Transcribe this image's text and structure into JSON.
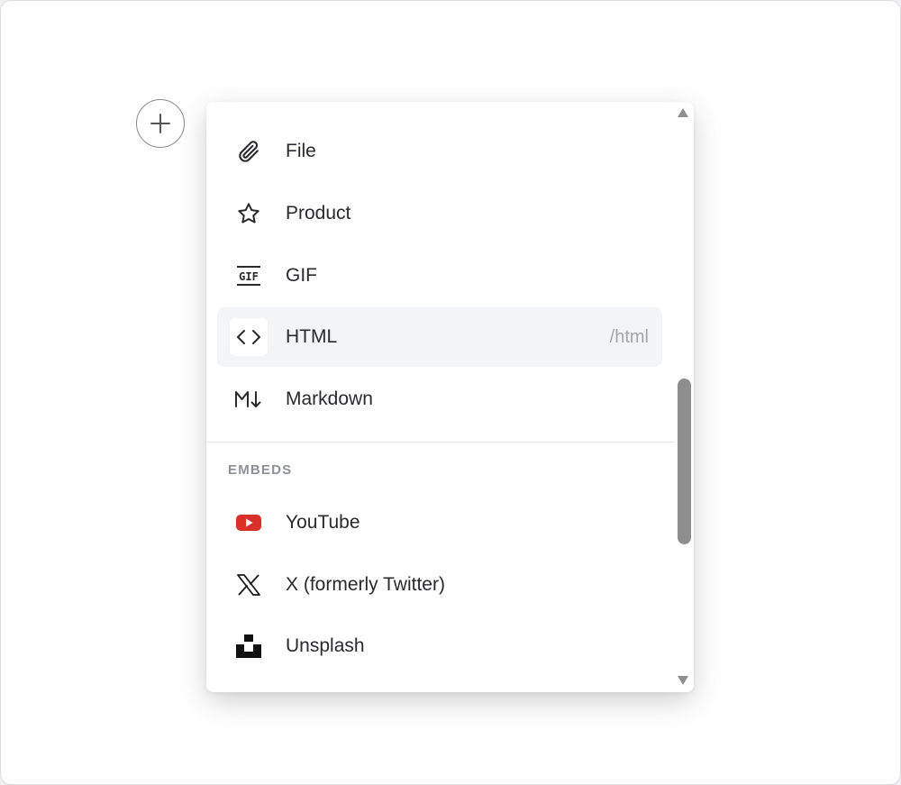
{
  "menu": {
    "items": [
      {
        "label": "File",
        "icon": "paperclip-icon"
      },
      {
        "label": "Product",
        "icon": "star-icon"
      },
      {
        "label": "GIF",
        "icon": "gif-icon"
      },
      {
        "label": "HTML",
        "icon": "code-icon",
        "shortcut": "/html",
        "active": true
      },
      {
        "label": "Markdown",
        "icon": "markdown-icon"
      }
    ],
    "embeds_header": "EMBEDS",
    "embeds": [
      {
        "label": "YouTube",
        "icon": "youtube-icon"
      },
      {
        "label": "X (formerly Twitter)",
        "icon": "x-twitter-icon"
      },
      {
        "label": "Unsplash",
        "icon": "unsplash-icon"
      }
    ]
  },
  "colors": {
    "active_bg": "#f3f4f6",
    "youtube_red": "#d9302c",
    "text": "#2a2a2e",
    "muted": "#a2a5ab",
    "scroll_thumb": "#8e8e8e"
  }
}
